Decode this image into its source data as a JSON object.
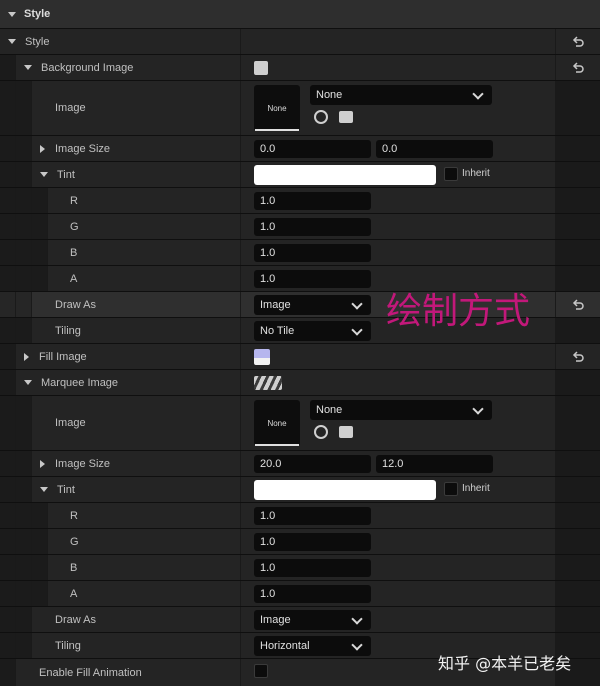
{
  "header": {
    "title": "Style"
  },
  "rows": {
    "style": {
      "label": "Style"
    },
    "bg_image": {
      "label": "Background Image"
    },
    "bg_img": {
      "label": "Image",
      "thumb": "None",
      "combo": "None"
    },
    "bg_size": {
      "label": "Image Size",
      "x": "0.0",
      "y": "0.0"
    },
    "bg_tint": {
      "label": "Tint",
      "inherit": "Inherit"
    },
    "bg_r": {
      "label": "R",
      "value": "1.0"
    },
    "bg_g": {
      "label": "G",
      "value": "1.0"
    },
    "bg_b": {
      "label": "B",
      "value": "1.0"
    },
    "bg_a": {
      "label": "A",
      "value": "1.0"
    },
    "bg_draw": {
      "label": "Draw As",
      "value": "Image"
    },
    "bg_tiling": {
      "label": "Tiling",
      "value": "No Tile"
    },
    "fill_image": {
      "label": "Fill Image"
    },
    "marquee_image": {
      "label": "Marquee Image"
    },
    "mq_img": {
      "label": "Image",
      "thumb": "None",
      "combo": "None"
    },
    "mq_size": {
      "label": "Image Size",
      "x": "20.0",
      "y": "12.0"
    },
    "mq_tint": {
      "label": "Tint",
      "inherit": "Inherit"
    },
    "mq_r": {
      "label": "R",
      "value": "1.0"
    },
    "mq_g": {
      "label": "G",
      "value": "1.0"
    },
    "mq_b": {
      "label": "B",
      "value": "1.0"
    },
    "mq_a": {
      "label": "A",
      "value": "1.0"
    },
    "mq_draw": {
      "label": "Draw As",
      "value": "Image"
    },
    "mq_tiling": {
      "label": "Tiling",
      "value": "Horizontal"
    },
    "fill_anim": {
      "label": "Enable Fill Animation"
    }
  },
  "annotation": {
    "text": "绘制方式",
    "color": "#c2187a"
  },
  "watermark": {
    "text": "知乎 @本羊已老矣"
  },
  "colors": {
    "tint": "#ffffff",
    "fill_swatch_top": "#b6b6ee",
    "fill_swatch_bottom": "#f2f2f2"
  }
}
